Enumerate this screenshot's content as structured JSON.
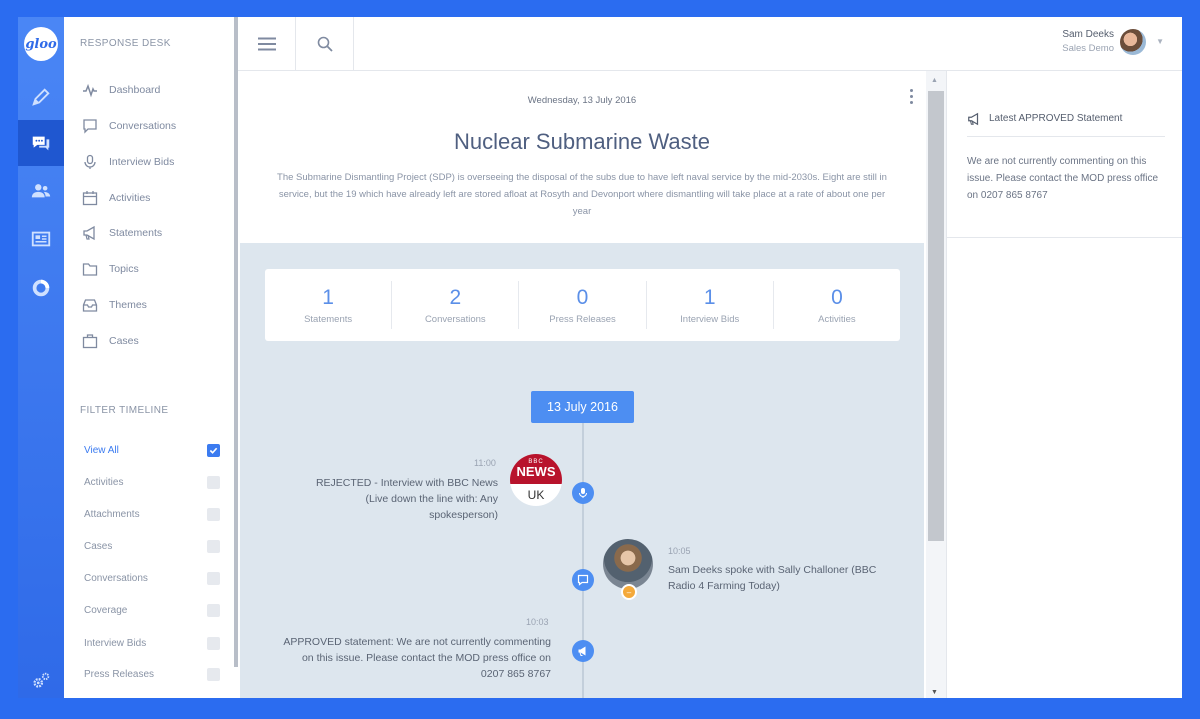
{
  "app": {
    "logo_text": "gloo",
    "section_title": "RESPONSE DESK"
  },
  "rail": [
    {
      "icon": "pencil-icon",
      "active": false
    },
    {
      "icon": "chat-bubbles-icon",
      "active": true
    },
    {
      "icon": "people-icon",
      "active": false
    },
    {
      "icon": "newspaper-icon",
      "active": false
    },
    {
      "icon": "donut-chart-icon",
      "active": false
    },
    {
      "icon": "gears-icon",
      "active": false
    }
  ],
  "nav": [
    {
      "label": "Dashboard",
      "icon": "activity-icon"
    },
    {
      "label": "Conversations",
      "icon": "chat-icon"
    },
    {
      "label": "Interview Bids",
      "icon": "microphone-icon"
    },
    {
      "label": "Activities",
      "icon": "calendar-icon"
    },
    {
      "label": "Statements",
      "icon": "megaphone-icon"
    },
    {
      "label": "Topics",
      "icon": "folder-icon"
    },
    {
      "label": "Themes",
      "icon": "inbox-icon"
    },
    {
      "label": "Cases",
      "icon": "briefcase-icon"
    }
  ],
  "filter": {
    "title": "FILTER TIMELINE",
    "items": [
      {
        "label": "View All",
        "checked": true
      },
      {
        "label": "Activities",
        "checked": false
      },
      {
        "label": "Attachments",
        "checked": false
      },
      {
        "label": "Cases",
        "checked": false
      },
      {
        "label": "Conversations",
        "checked": false
      },
      {
        "label": "Coverage",
        "checked": false
      },
      {
        "label": "Interview Bids",
        "checked": false
      },
      {
        "label": "Press Releases",
        "checked": false
      }
    ]
  },
  "user": {
    "name": "Sam Deeks",
    "role": "Sales Demo"
  },
  "issue": {
    "date": "Wednesday, 13 July 2016",
    "title": "Nuclear Submarine Waste",
    "description": "The Submarine Dismantling Project (SDP) is overseeing the disposal of the subs due to have left naval service by the mid-2030s. Eight are still in service, but the 19 which have already left are stored afloat at Rosyth and Devonport where dismantling will take place at a rate of about one per year"
  },
  "stats": [
    {
      "value": "1",
      "label": "Statements"
    },
    {
      "value": "2",
      "label": "Conversations"
    },
    {
      "value": "0",
      "label": "Press Releases"
    },
    {
      "value": "1",
      "label": "Interview Bids"
    },
    {
      "value": "0",
      "label": "Activities"
    }
  ],
  "timeline": {
    "date_badge": "13 July 2016",
    "entries": [
      {
        "time": "11:00",
        "text": "REJECTED - Interview with BBC News (Live down the line with: Any spokesperson)",
        "icon": "microphone-icon",
        "logo_top": "BBC",
        "logo_mid": "NEWS",
        "logo_bottom": "UK"
      },
      {
        "time": "10:05",
        "text": "Sam Deeks spoke with Sally Challoner (BBC Radio 4 Farming Today)",
        "icon": "chat-icon"
      },
      {
        "time": "10:03",
        "text": "APPROVED statement: We are not currently commenting on this issue. Please contact the MOD press office on 0207 865 8767",
        "icon": "megaphone-icon"
      }
    ]
  },
  "right_panel": {
    "heading": "Latest APPROVED Statement",
    "body": "We are not currently commenting on this issue. Please contact the MOD press office on 0207 865 8767"
  },
  "colors": {
    "brand": "#2f6ae8",
    "accent": "#4d8ef2",
    "timeline_bg": "#dde6ee",
    "bbc_red": "#b8132c",
    "badge_orange": "#f4a93a"
  }
}
